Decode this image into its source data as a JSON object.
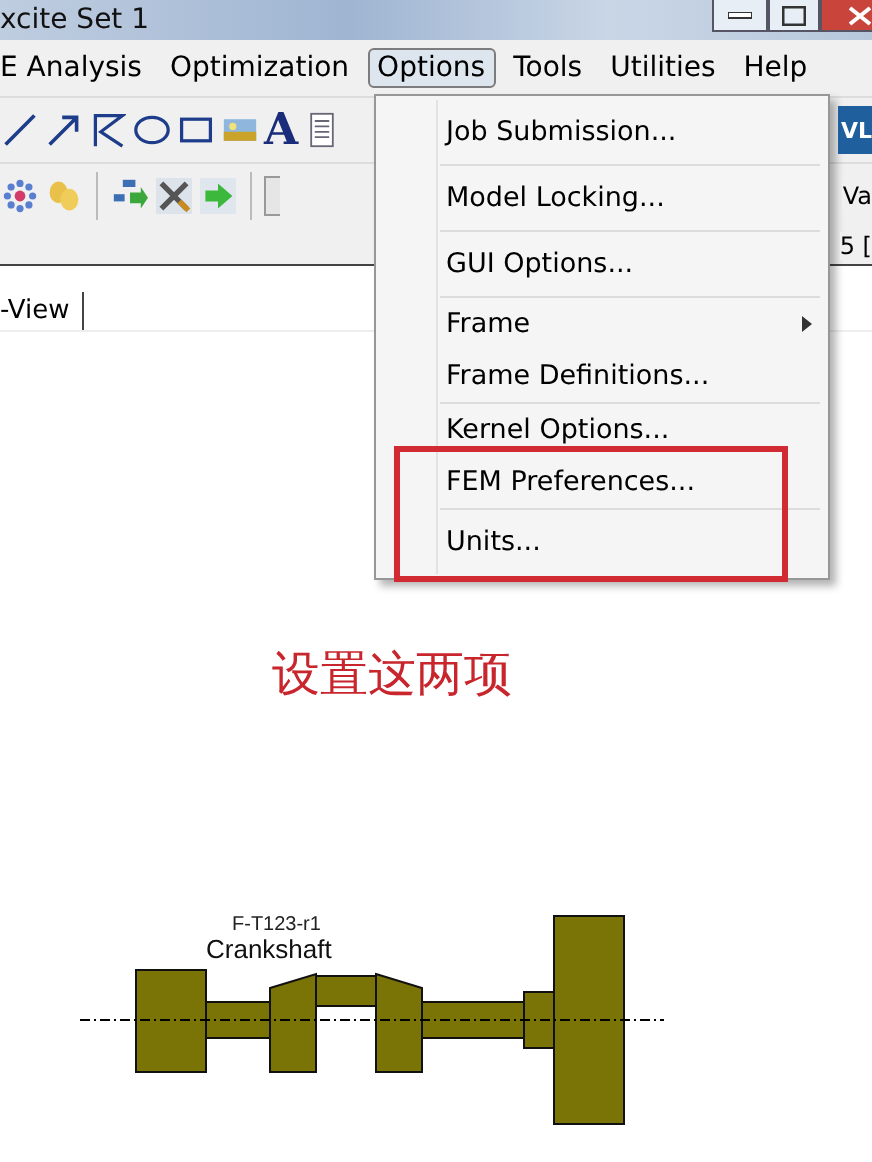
{
  "window": {
    "title": "xcite Set 1"
  },
  "menubar": [
    {
      "label": "E Analysis",
      "selected": false
    },
    {
      "label": "Optimization",
      "selected": false
    },
    {
      "label": "Options",
      "selected": true
    },
    {
      "label": "Tools",
      "selected": false
    },
    {
      "label": "Utilities",
      "selected": false
    },
    {
      "label": "Help",
      "selected": false
    }
  ],
  "toolbar_1": {
    "text_tool_glyph": "A",
    "right_partial": "VL"
  },
  "toolbar_2": {
    "right_partial": "Va"
  },
  "info_row": {
    "right_partial": "5 ["
  },
  "view_tab": {
    "label": "-View"
  },
  "options_menu": {
    "groups": [
      [
        {
          "label": "Job Submission...",
          "submenu": false
        }
      ],
      [
        {
          "label": "Model Locking...",
          "submenu": false
        }
      ],
      [
        {
          "label": "GUI Options...",
          "submenu": false
        }
      ],
      [
        {
          "label": "Frame",
          "submenu": true
        },
        {
          "label": "Frame Definitions...",
          "submenu": false
        }
      ],
      [
        {
          "label": "Kernel Options...",
          "submenu": false
        },
        {
          "label": "FEM Preferences...",
          "submenu": false
        }
      ],
      [
        {
          "label": "Units...",
          "submenu": false
        }
      ]
    ]
  },
  "annotation": {
    "text": "设置这两项"
  },
  "diagram": {
    "part_id": "F-T123-r1",
    "part_name": "Crankshaft"
  }
}
